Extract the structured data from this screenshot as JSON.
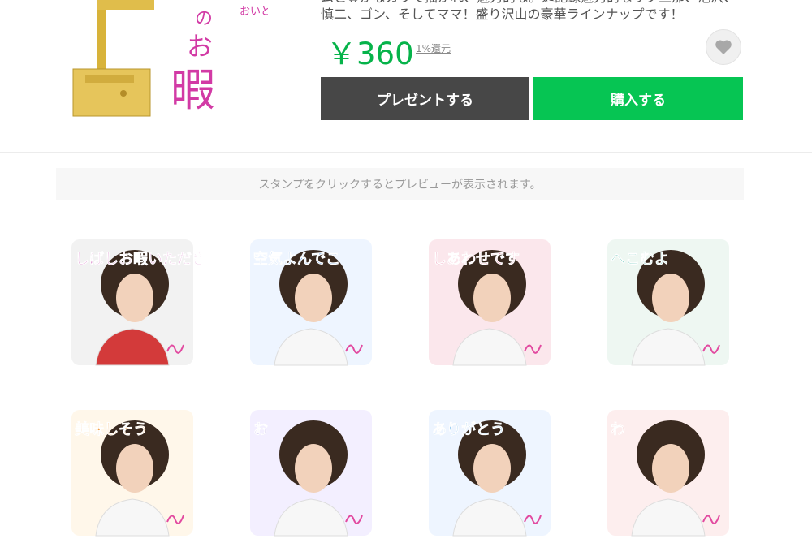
{
  "product": {
    "title_art": [
      "おいとま",
      "の",
      "お",
      "暇"
    ],
    "description": "ムと豊かなカラで描かれ、魅力的な。通記録魅力的なリク旦那、池沢、\n慎二、ゴン、そしてママ！盛り沢山の豪華ラインナップです！",
    "price": "￥360",
    "reward_link": "1%還元"
  },
  "actions": {
    "favorite_icon": "heart-icon",
    "present_label": "プレゼントする",
    "buy_label": "購入する"
  },
  "preview_notice": "スタンプをクリックするとプレビューが表示されます。",
  "stickers": [
    {
      "caption": "しばしお暇いただきます",
      "bg": "#f2f2f2",
      "shirt": "#d33a3a",
      "text_color": "#c23aa8"
    },
    {
      "caption": "空気よんでこ",
      "bg": "#eef5ff",
      "shirt": "#f7f7f7",
      "text_color": "#4a8ee0"
    },
    {
      "caption": "しあわせです",
      "bg": "#fbe7ec",
      "shirt": "#f7f7f7",
      "text_color": "#e0467a"
    },
    {
      "caption": "へこむよ",
      "bg": "#eef7f2",
      "shirt": "#f7f7f7",
      "text_color": "#2fae9d"
    },
    {
      "caption": "美味しそう",
      "bg": "#fff7ea",
      "shirt": "#f7f7f7",
      "text_color": "#f08a1e"
    },
    {
      "caption": "お",
      "bg": "#f3efff",
      "shirt": "#f7f7f7",
      "text_color": "#6a4ad0"
    },
    {
      "caption": "ありがとう",
      "bg": "#eef5ff",
      "shirt": "#f7f7f7",
      "text_color": "#3a9ae0"
    },
    {
      "caption": "わ",
      "bg": "#fdeeee",
      "shirt": "#f7f7f7",
      "text_color": "#e04646"
    }
  ],
  "colors": {
    "price_green": "#06b34a",
    "buy_green": "#06c553",
    "present_gray": "#474747"
  }
}
